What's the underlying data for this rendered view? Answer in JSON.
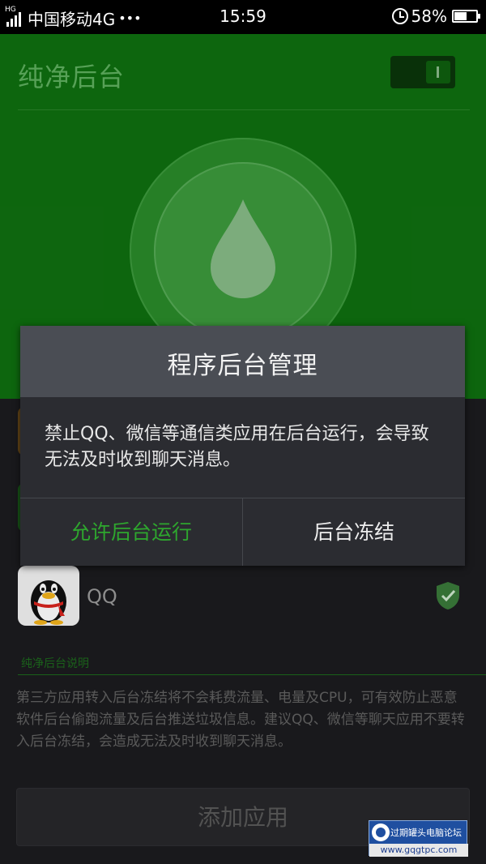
{
  "status_bar": {
    "network_tag": "HG",
    "carrier": "中国移动4G",
    "more": "•••",
    "time": "15:59",
    "battery": "58%",
    "battery_level": 0.58
  },
  "page": {
    "title": "纯净后台",
    "toggle_on": true,
    "icon": "water-drop-icon"
  },
  "app_list": {
    "items": [
      {
        "name": "QQ",
        "icon": "qq-penguin-icon",
        "status_icon": "shield-check-icon"
      }
    ]
  },
  "info": {
    "section_title": "纯净后台说明",
    "description": "第三方应用转入后台冻结将不会耗费流量、电量及CPU，可有效防止恶意软件后台偷跑流量及后台推送垃圾信息。建议QQ、微信等聊天应用不要转入后台冻结，会造成无法及时收到聊天消息。"
  },
  "add_button": {
    "label": "添加应用"
  },
  "dialog": {
    "title": "程序后台管理",
    "message": "禁止QQ、微信等通信类应用在后台运行，会导致无法及时收到聊天消息。",
    "allow_label": "允许后台运行",
    "freeze_label": "后台冻结"
  },
  "watermark": {
    "line1": "过期罐头电脑论坛",
    "line2": "www.gqgtpc.com"
  },
  "colors": {
    "accent_green": "#2ea62e",
    "header_green": "#0f6f10",
    "dialog_bg": "#2b2c31"
  }
}
